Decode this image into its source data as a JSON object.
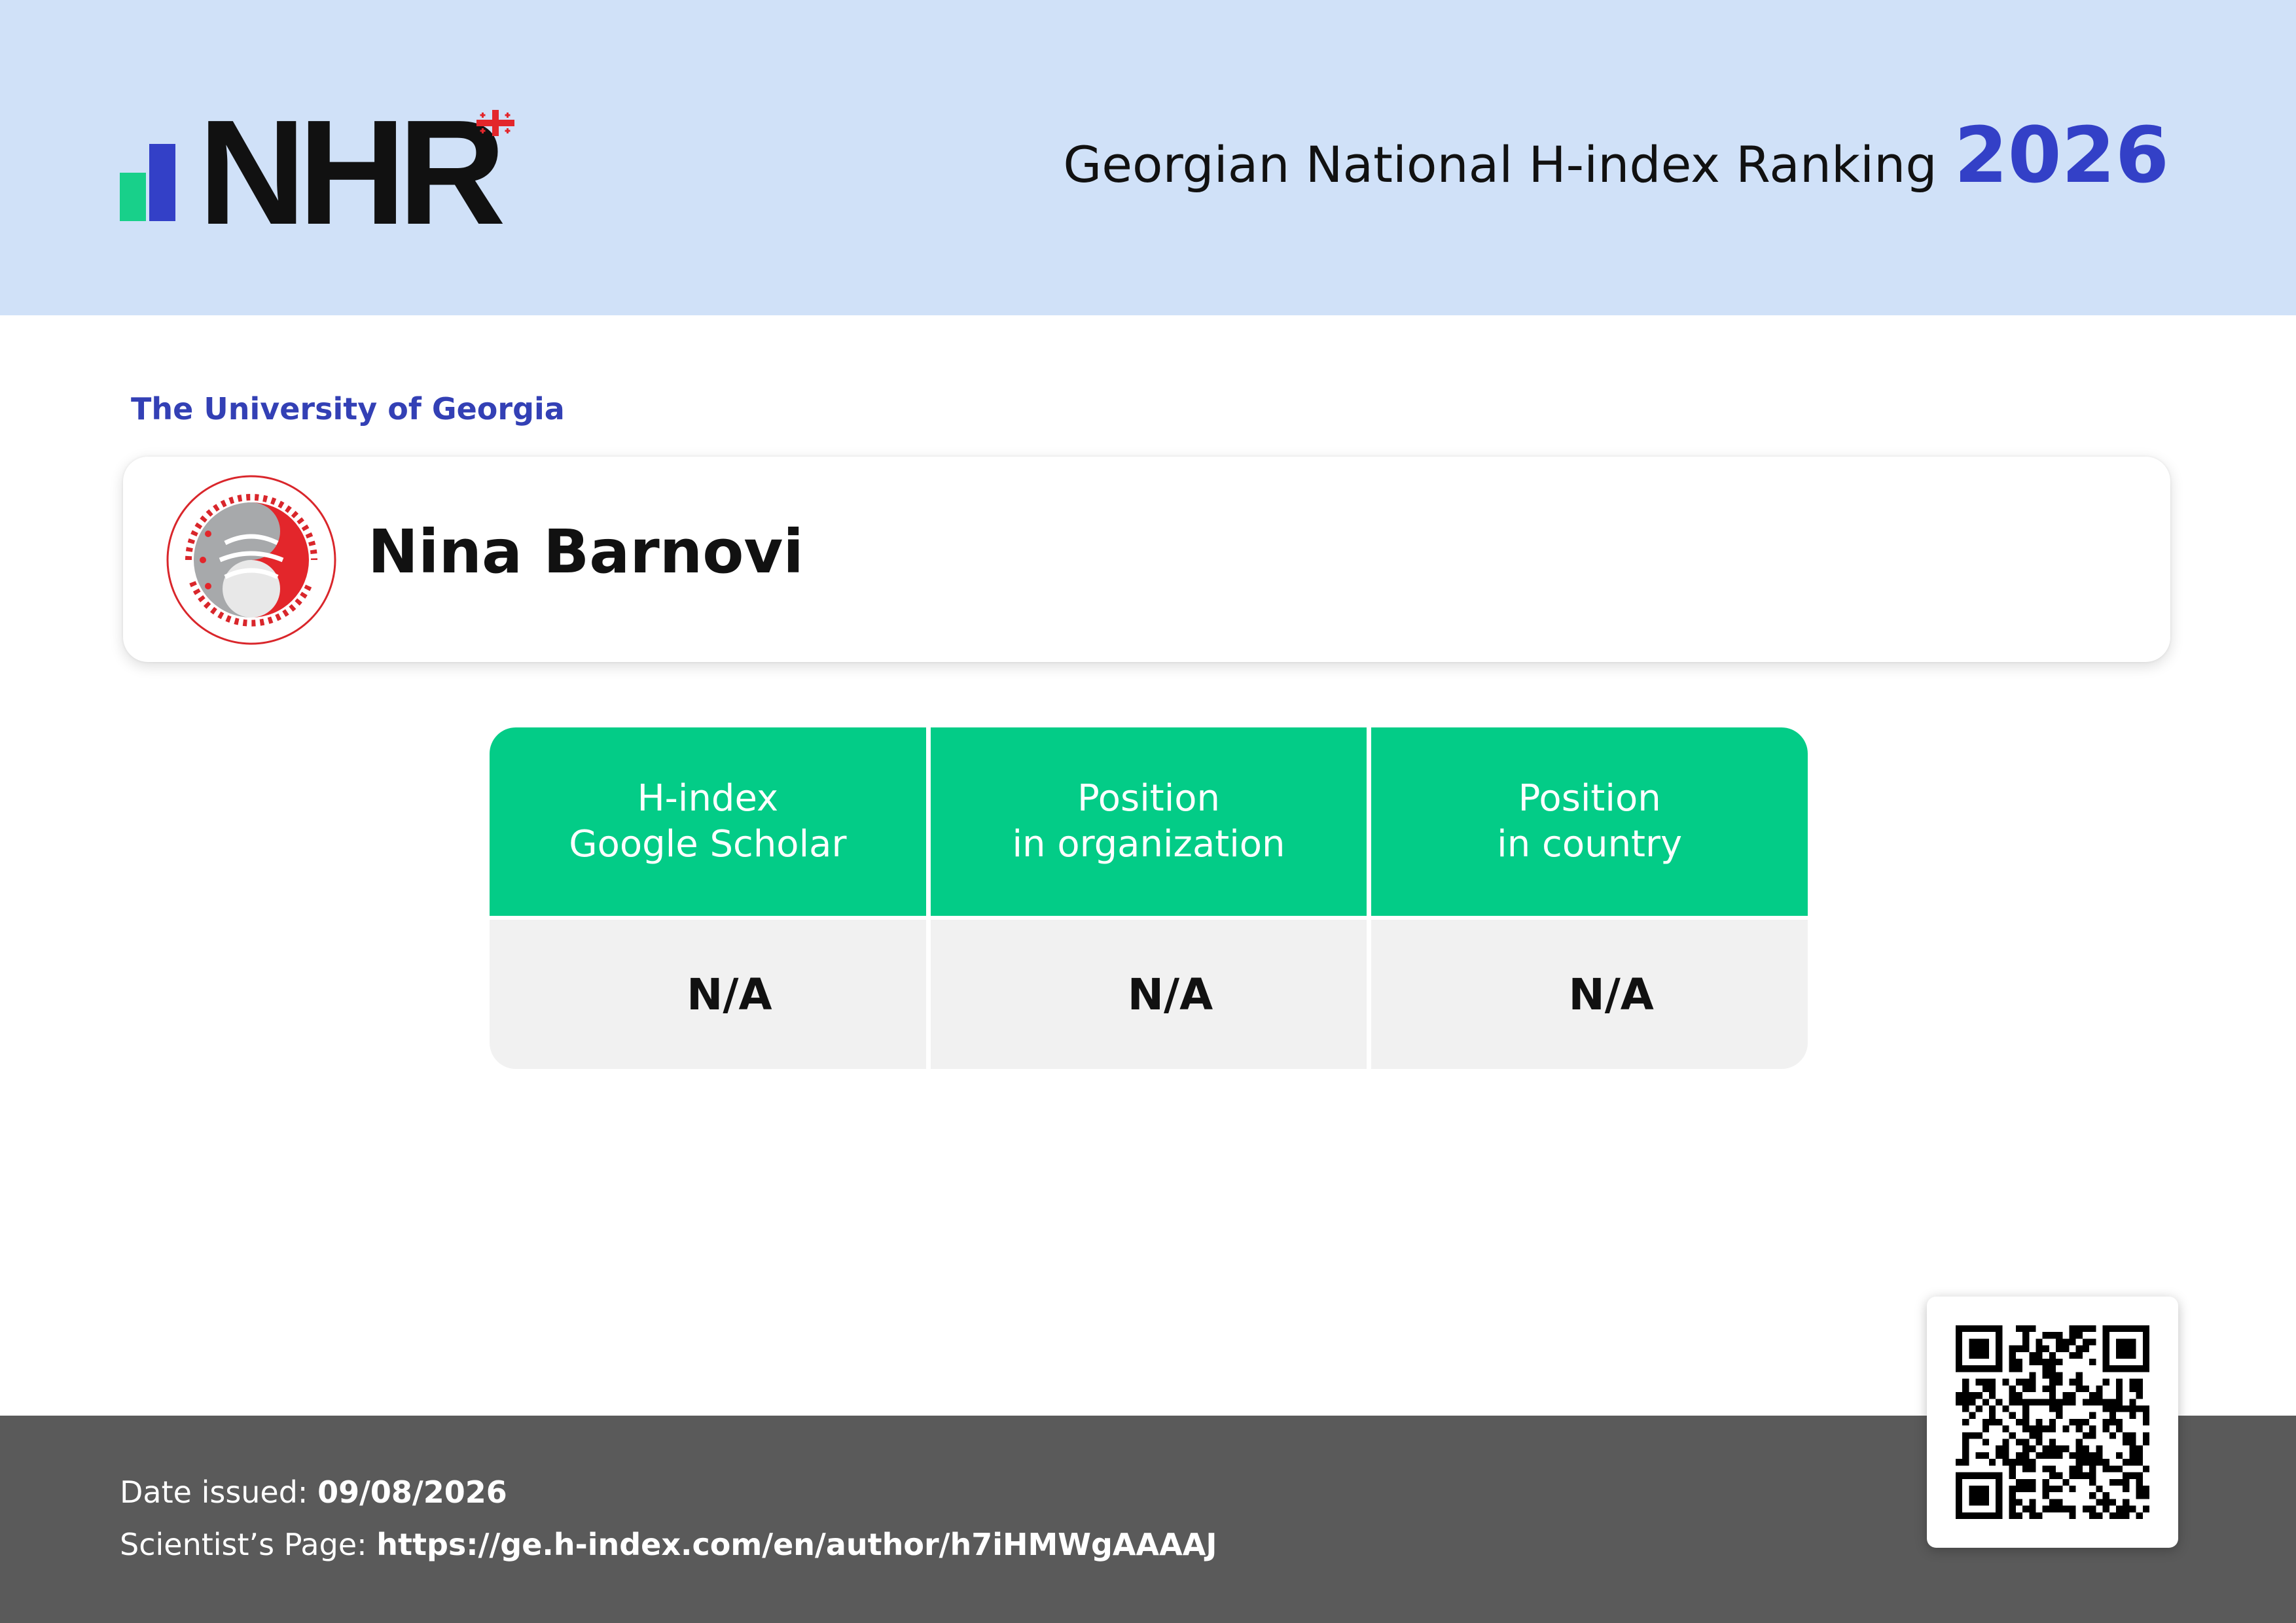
{
  "header": {
    "logo_text": "NHR",
    "title": "Georgian National H-index Ranking",
    "year": "2026",
    "colors": {
      "background": "#d0e1f8",
      "year": "#3340c7",
      "logo_bar_green": "#18d08a",
      "logo_bar_blue": "#3340c7",
      "flag_red": "#e3262b"
    }
  },
  "organization": {
    "name": "The University of Georgia",
    "seal_icon": "university-of-georgia-seal"
  },
  "scientist": {
    "name": "Nina Barnovi"
  },
  "stats": {
    "columns": [
      {
        "label_line1": "H-index",
        "label_line2": "Google Scholar",
        "value": "N/A"
      },
      {
        "label_line1": "Position",
        "label_line2": "in organization",
        "value": "N/A"
      },
      {
        "label_line1": "Position",
        "label_line2": "in country",
        "value": "N/A"
      }
    ],
    "colors": {
      "header": "#03cc87",
      "value_bg": "#f1f1f1"
    }
  },
  "footer": {
    "date_label": "Date issued:",
    "date_value": "09/08/2026",
    "page_label": "Scientist’s Page:",
    "page_url": "https://ge.h-index.com/en/author/h7iHMWgAAAAJ",
    "qr_icon": "qr-code",
    "colors": {
      "background": "#5a5a5a"
    }
  }
}
